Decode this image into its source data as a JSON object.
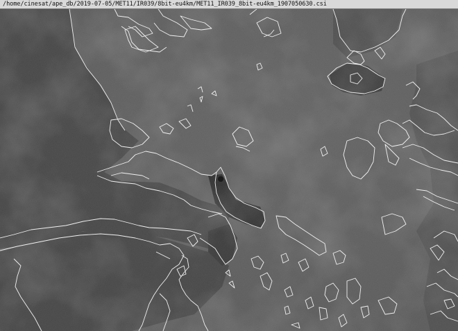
{
  "window": {
    "title": "/home/cinesat/ape_db/2019-07-05/MET11/IR039/8bit-eu4km/MET11_IR039_8bit-eu4km_1907050630.csi"
  },
  "image": {
    "coastline_color": "#f2f2f2"
  }
}
